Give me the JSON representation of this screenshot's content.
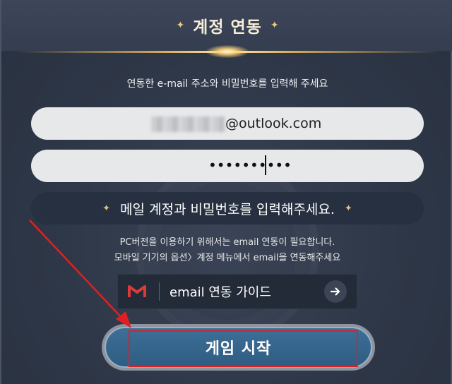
{
  "dialog": {
    "title": "계정 연동",
    "title_ornament": "✦",
    "instruction": "연동한 e-mail 주소와 비밀번호를 입력해 주세요"
  },
  "form": {
    "email_value": "@outlook.com",
    "password_value": "••••••••••"
  },
  "warning": {
    "message": "메일 계정과 비밀번호를 입력해주세요.",
    "ornament": "✦"
  },
  "notes": [
    "PC버전을 이용하기 위해서는 email 연동이 필요합니다.",
    "모바일 기기의 옵션〉계정 메뉴에서 email을 연동해주세요"
  ],
  "guide_button": {
    "label": "email 연동 가이드",
    "icon": "gmail-m-icon",
    "arrow_icon": "arrow-right-icon"
  },
  "start_button": {
    "label": "게임 시작"
  },
  "colors": {
    "background": "#2f3848",
    "accent_gold": "#d7ab5c",
    "start_button": "#3d6f98",
    "annotation_red": "#e02020"
  }
}
